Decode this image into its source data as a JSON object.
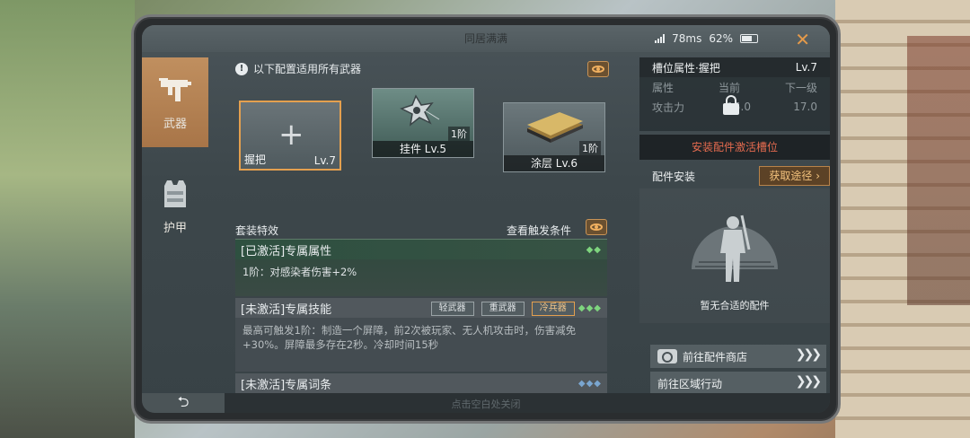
{
  "window": {
    "title": "同居满满",
    "ping": "78ms",
    "battery": "62%"
  },
  "sidebar": {
    "items": [
      {
        "label": "武器",
        "icon": "smg-icon",
        "active": true
      },
      {
        "label": "护甲",
        "icon": "vest-icon",
        "active": false
      }
    ]
  },
  "main": {
    "info_text": "以下配置适用所有武器",
    "slots": [
      {
        "name": "握把",
        "level": "Lv.7",
        "selected": true,
        "empty": true
      },
      {
        "name": "挂件 Lv.5",
        "tier": "1阶",
        "icon": "shuriken-icon"
      },
      {
        "name": "涂层 Lv.6",
        "tier": "1阶",
        "icon": "coating-plates-icon"
      }
    ],
    "set_effect_label": "套装特效",
    "trigger_label": "查看触发条件",
    "active_panel": {
      "title": "[已激活]专属属性",
      "body": "1阶：对感染者伤害+2%"
    },
    "skill_panel": {
      "title": "[未激活]专属技能",
      "chips": [
        "轻武器",
        "重武器",
        "冷兵器"
      ],
      "selected_chip": 2,
      "body": "最高可触发1阶：制造一个屏障，前2次被玩家、无人机攻击时，伤害减免+30%。屏障最多存在2秒。冷却时间15秒"
    },
    "words_panel": {
      "title": "[未激活]专属词条"
    }
  },
  "right_panel": {
    "header_title": "槽位属性·握把",
    "header_level": "Lv.7",
    "table": {
      "columns": [
        "属性",
        "当前",
        "下一级"
      ],
      "row": [
        "攻击力",
        "15.0",
        "17.0"
      ]
    },
    "activate_text": "安装配件激活槽位",
    "install_label": "配件安装",
    "get_button": "获取途径",
    "empty_text": "暂无合适的配件",
    "links": [
      "前往配件商店",
      "前往区域行动"
    ]
  },
  "bottom": {
    "hint": "点击空白处关闭"
  },
  "colors": {
    "accent": "#e4a04f",
    "active_green": "#7ed57e",
    "warning_red": "#e56b4f"
  }
}
